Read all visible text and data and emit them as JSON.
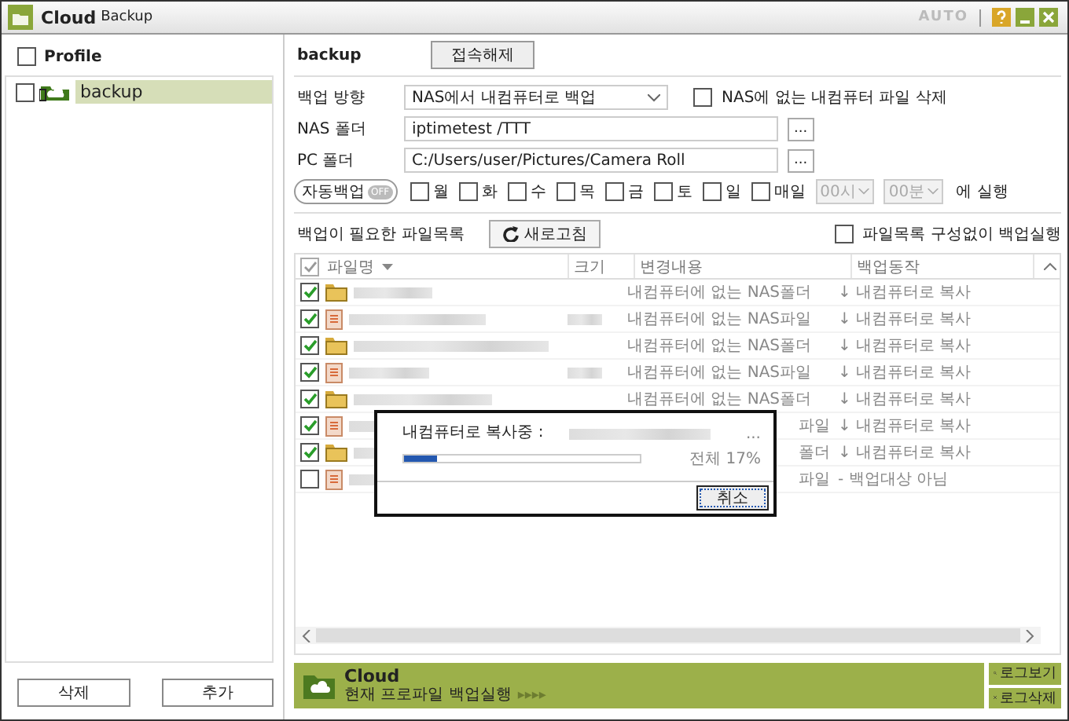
{
  "window": {
    "title_main": "Cloud",
    "title_sub": "Backup",
    "mode": "AUTO"
  },
  "profiles": {
    "header": {
      "label": "Profile",
      "checked": false
    },
    "items": [
      {
        "label": "backup",
        "checked": false,
        "selected": true
      }
    ],
    "buttons": [
      "삭제",
      "추가"
    ]
  },
  "profile_bar": {
    "name": "backup",
    "button": "접속해제"
  },
  "settings": {
    "direction_label": "백업 방향",
    "direction_value": "NAS에서 내컴퓨터로 백업",
    "delete_option": {
      "label": "NAS에 없는 내컴퓨터 파일 삭제",
      "checked": false
    },
    "nas_label": "NAS 폴더",
    "nas_value": "iptimetest /TTT",
    "browse": "...",
    "pc_label": "PC 폴더",
    "pc_value": "C:/Users/user/Pictures/Camera Roll",
    "browse2": "...",
    "auto_label": "자동백업",
    "auto_state": "OFF",
    "auto_on": false,
    "days": [
      {
        "label": "월",
        "checked": false
      },
      {
        "label": "화",
        "checked": false
      },
      {
        "label": "수",
        "checked": false
      },
      {
        "label": "목",
        "checked": false
      },
      {
        "label": "금",
        "checked": false
      },
      {
        "label": "토",
        "checked": false
      },
      {
        "label": "일",
        "checked": false
      },
      {
        "label": "매일",
        "checked": false
      }
    ],
    "hour": "00시",
    "minute": "00분",
    "run_label": "에 실행"
  },
  "file_list": {
    "title": "백업이 필요한 파일목록",
    "refresh": "새로고침",
    "skip_option": {
      "label": "파일목록 구성없이 백업실행",
      "checked": false
    },
    "header_checked": true,
    "columns": [
      "파일명",
      "크기",
      "변경내용",
      "백업동작"
    ],
    "rows": [
      {
        "checked": true,
        "kind": "folder",
        "change": "내컴퓨터에 없는 NAS폴더",
        "action": "↓ 내컴퓨터로 복사",
        "covered": false
      },
      {
        "checked": true,
        "kind": "file",
        "change": "내컴퓨터에 없는 NAS파일",
        "action": "↓ 내컴퓨터로 복사",
        "covered": false
      },
      {
        "checked": true,
        "kind": "folder",
        "change": "내컴퓨터에 없는 NAS폴더",
        "action": "↓ 내컴퓨터로 복사",
        "covered": false
      },
      {
        "checked": true,
        "kind": "file",
        "change": "내컴퓨터에 없는 NAS파일",
        "action": "↓ 내컴퓨터로 복사",
        "covered": false
      },
      {
        "checked": true,
        "kind": "folder",
        "change": "내컴퓨터에 없는 NAS폴더",
        "action": "↓ 내컴퓨터로 복사",
        "covered": false
      },
      {
        "checked": true,
        "kind": "file",
        "change": "파일",
        "action": "↓ 내컴퓨터로 복사",
        "covered": true
      },
      {
        "checked": true,
        "kind": "folder",
        "change": "폴더",
        "action": "↓ 내컴퓨터로 복사",
        "covered": true
      },
      {
        "checked": false,
        "kind": "file",
        "change": "파일",
        "action": "- 백업대상 아님",
        "covered": true
      }
    ]
  },
  "progress_dialog": {
    "label": "내컴퓨터로 복사중 :",
    "ellipsis": "...",
    "level": 0.14,
    "total": "전체 17%",
    "cancel": "취소"
  },
  "bottom_bar": {
    "title": "Cloud",
    "subtitle": "현재 프로파일 백업실행",
    "arrows": "▸▸▸▸",
    "log_view": "로그보기",
    "log_delete": "로그삭제"
  }
}
